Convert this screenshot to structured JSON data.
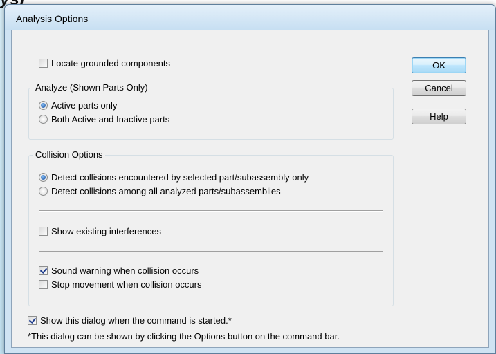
{
  "background": {
    "fragment_text": "ysi"
  },
  "window": {
    "title": "Analysis Options"
  },
  "options": {
    "locate_grounded": {
      "label": "Locate grounded components",
      "checked": false
    },
    "show_dialog": {
      "label": "Show this dialog when the command is started.*",
      "checked": true
    }
  },
  "analyze_group": {
    "title": "Analyze (Shown Parts Only)",
    "options": [
      {
        "label": "Active parts only",
        "selected": true
      },
      {
        "label": "Both Active and Inactive parts",
        "selected": false
      }
    ]
  },
  "collision_group": {
    "title": "Collision Options",
    "radios": [
      {
        "label": "Detect collisions encountered by selected part/subassembly only",
        "selected": true
      },
      {
        "label": "Detect collisions among all analyzed parts/subassemblies",
        "selected": false
      }
    ],
    "show_interferences": {
      "label": "Show existing interferences",
      "checked": false
    },
    "sound_warning": {
      "label": "Sound warning when collision occurs",
      "checked": true
    },
    "stop_movement": {
      "label": "Stop movement when collision occurs",
      "checked": false
    }
  },
  "buttons": {
    "ok": "OK",
    "cancel": "Cancel",
    "help": "Help"
  },
  "footnote": "*This dialog can be shown by clicking the Options button on the command bar."
}
